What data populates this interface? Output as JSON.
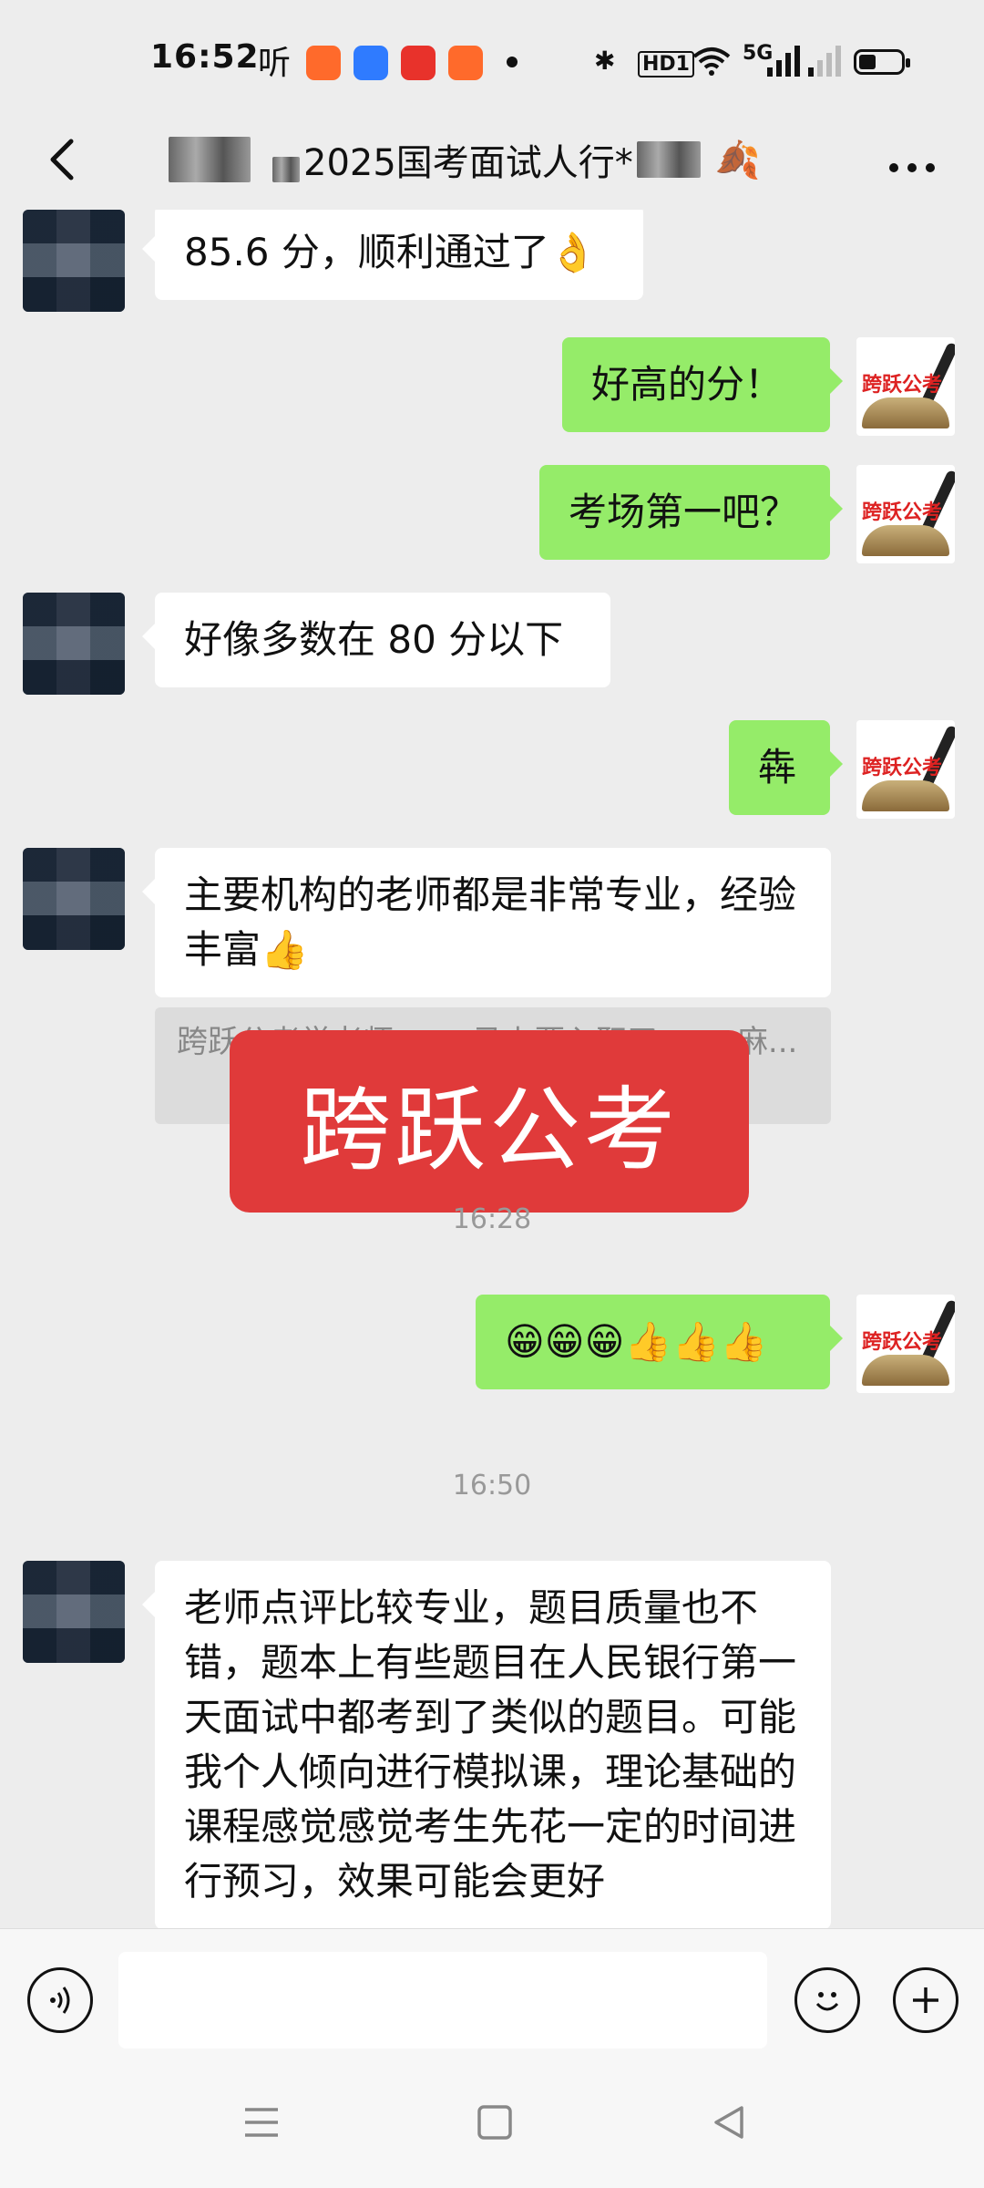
{
  "status_bar": {
    "time": "16:52",
    "ting": "听",
    "network": "5G",
    "hd": "HD1",
    "battery_level": 0.35
  },
  "header": {
    "title": "2025国考面试人行*"
  },
  "messages": [
    {
      "side": "in",
      "text": "85.6 分，顺利通过了👌"
    },
    {
      "side": "out",
      "text": "好高的分！"
    },
    {
      "side": "out",
      "text": "考场第一吧？"
    },
    {
      "side": "in",
      "text": "好像多数在 80 分以下"
    },
    {
      "side": "out",
      "text": "犇"
    },
    {
      "side": "in",
      "text": "主要机构的老师都是非常专业，经验丰富👍"
    },
    {
      "side": "out",
      "text": "😁😁😁👍👍👍"
    },
    {
      "side": "in",
      "text": "老师点评比较专业，题目质量也不错，题本上有些题目在人民银行第一天面试中都考到了类似的题目。可能我个人倾向进行模拟课，理论基础的课程感觉感觉考生先花一定的时间进行预习，效果可能会更好"
    }
  ],
  "quote": {
    "text": "跨跃公考学老师 ...... 马上要入职了 ...... 麻..."
  },
  "watermark": "跨跃公考",
  "brand_avatar_label": "跨跃公考",
  "timestamps": [
    "16:28",
    "16:50"
  ],
  "input": {
    "value": "",
    "placeholder": ""
  },
  "icons": {
    "back": "chevron-left-icon",
    "more": "more-dots-icon",
    "voice": "voice-icon",
    "emoji": "emoji-icon",
    "add": "plus-icon"
  },
  "colors": {
    "outgoing_bubble": "#95ec69",
    "incoming_bubble": "#ffffff",
    "watermark": "#e03a3a",
    "background": "#ededed"
  }
}
